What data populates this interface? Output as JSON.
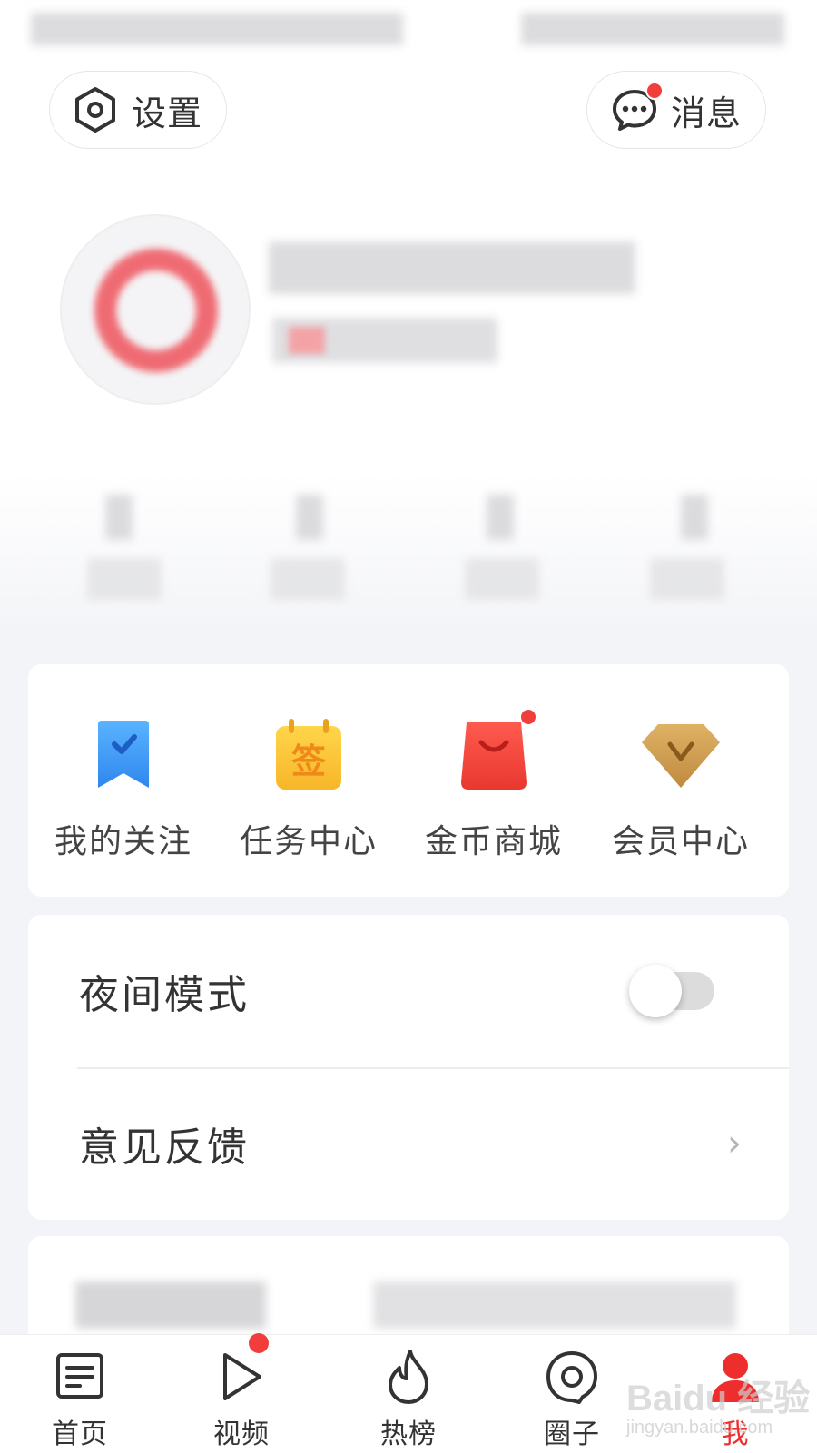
{
  "header": {
    "settings_label": "设置",
    "messages_label": "消息"
  },
  "quick_actions": [
    {
      "label": "我的关注",
      "icon": "bookmark-icon",
      "color": "#3b9bf5"
    },
    {
      "label": "任务中心",
      "icon": "sign-in-calendar-icon",
      "badge_text": "签",
      "color": "#fcc233"
    },
    {
      "label": "金币商城",
      "icon": "shopping-bag-icon",
      "color": "#f5413c"
    },
    {
      "label": "会员中心",
      "icon": "diamond-icon",
      "color": "#c89a4e"
    }
  ],
  "settings": {
    "night_mode_label": "夜间模式",
    "night_mode_on": false,
    "feedback_label": "意见反馈"
  },
  "tabs": [
    {
      "label": "首页",
      "icon": "home-news-icon"
    },
    {
      "label": "视频",
      "icon": "video-play-icon"
    },
    {
      "label": "热榜",
      "icon": "hot-fire-icon"
    },
    {
      "label": "圈子",
      "icon": "circle-icon"
    },
    {
      "label": "我",
      "icon": "profile-icon",
      "active": true
    }
  ],
  "watermark": {
    "line1": "Baidu 经验",
    "line2": "jingyan.baidu.com"
  },
  "colors": {
    "accent_red": "#ee2d2d",
    "badge_red": "#f23d3d"
  }
}
